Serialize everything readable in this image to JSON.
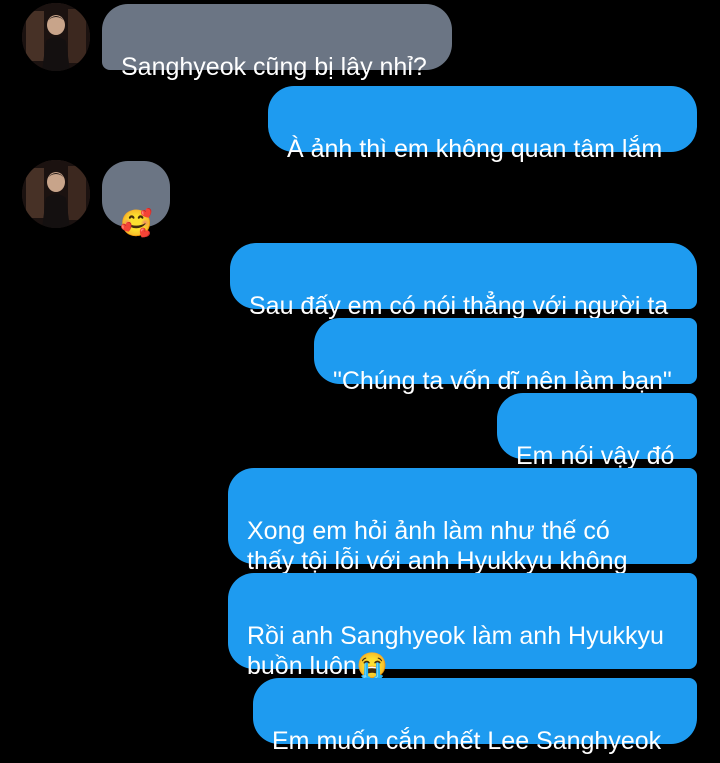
{
  "contact": {
    "avatar_icon": "profile-photo"
  },
  "messages": [
    {
      "side": "in",
      "text": "Sanghyeok cũng bị lây nhỉ?"
    },
    {
      "side": "out",
      "text": "À ảnh thì em không quan tâm lắm"
    },
    {
      "side": "in",
      "text": "🥰",
      "icon": "smiling-face-with-hearts-emoji"
    },
    {
      "side": "out",
      "text": "Sau đấy em có nói thẳng với người ta"
    },
    {
      "side": "out",
      "text": "\"Chúng ta vốn dĩ nên làm bạn\""
    },
    {
      "side": "out",
      "text": "Em nói vậy đó"
    },
    {
      "side": "out",
      "text": "Xong em hỏi ảnh làm như thế có\nthấy tội lỗi với anh Hyukkyu không"
    },
    {
      "side": "out",
      "text": "Rồi anh Sanghyeok làm anh Hyukkyu\nbuồn luôn😭",
      "icon": "loudly-crying-face-emoji"
    },
    {
      "side": "out",
      "text": "Em muốn cắn chết Lee Sanghyeok"
    }
  ],
  "colors": {
    "background": "#000000",
    "incoming_bubble": "#6b7584",
    "outgoing_bubble": "#1e9bf0",
    "text": "#ffffff"
  }
}
